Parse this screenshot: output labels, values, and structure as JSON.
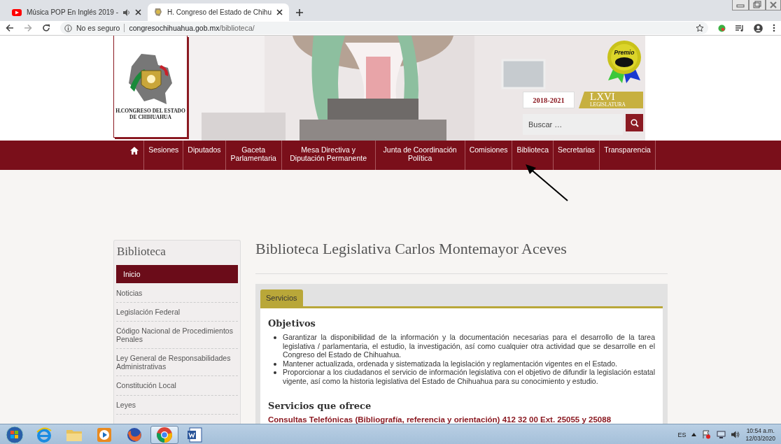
{
  "browser": {
    "tabs": [
      {
        "title": "Música POP En Inglés 2019 -",
        "selected": false,
        "audio": true
      },
      {
        "title": "H. Congreso del Estado de Chihu",
        "selected": true,
        "audio": false
      }
    ],
    "security": "No es seguro",
    "url_host": "congresochihuahua.gob.mx",
    "url_path": "/biblioteca/"
  },
  "header": {
    "logo_lines": [
      "H.CONGRESO DEL ESTADO",
      "DE CHIHUAHUA"
    ],
    "badge": "Premio",
    "period": "2018-2021",
    "legislature": "LXVI",
    "legislature_sub": "LEGISLATURA",
    "search_placeholder": "Buscar …"
  },
  "nav": [
    {
      "label": "Sesiones"
    },
    {
      "label": "Diputados"
    },
    {
      "label": "Gaceta Parlamentaria"
    },
    {
      "label": "Mesa Directiva y Diputación Permanente"
    },
    {
      "label": "Junta de Coordinación Política"
    },
    {
      "label": "Comisiones"
    },
    {
      "label": "Biblioteca"
    },
    {
      "label": "Secretarias"
    },
    {
      "label": "Transparencia"
    }
  ],
  "sidebar": {
    "title": "Biblioteca",
    "items": [
      {
        "label": "Inicio",
        "selected": true
      },
      {
        "label": "Noticias",
        "selected": false
      },
      {
        "label": "Legislación Federal",
        "selected": false
      },
      {
        "label": "Código Nacional de Procedimientos Penales",
        "selected": false
      },
      {
        "label": "Ley General de Responsabilidades Administrativas",
        "selected": false
      },
      {
        "label": "Constitución Local",
        "selected": false
      },
      {
        "label": "Leyes",
        "selected": false
      }
    ]
  },
  "main": {
    "title": "Biblioteca Legislativa Carlos Montemayor Aceves",
    "tabs": [
      {
        "label": "Servicios",
        "selected": true
      }
    ],
    "objectives_heading": "Objetivos",
    "objectives": [
      "Garantizar la disponibilidad de la información y la documentación necesarias para el desarrollo de la tarea legislativa / parlamentaria, el estudio, la investigación, así como cualquier otra actividad que se desarrolle en el Congreso del Estado de Chihuahua.",
      "Mantener actualizada, ordenada y sistematizada la legislación y reglamentación vigentes en el Estado.",
      "Proporcionar a los ciudadanos el servicio de información legislativa con el objetivo de difundir la legislación estatal vigente, así como la historia legislativa del Estado de Chihuahua para su conocimiento y estudio."
    ],
    "services_heading": "Servicios que ofrece",
    "services": [
      "Consultas Telefónicas (Bibliografía, referencia y orientación) 412 32 00 Ext. 25055 y 25088"
    ]
  },
  "taskbar": {
    "apps": [
      {
        "kind": "start",
        "active": false
      },
      {
        "kind": "ie",
        "active": false
      },
      {
        "kind": "folder",
        "active": false
      },
      {
        "kind": "media",
        "active": false
      },
      {
        "kind": "firefox",
        "active": false
      },
      {
        "kind": "chrome",
        "active": true
      },
      {
        "kind": "word",
        "active": false
      }
    ],
    "language": "ES",
    "time": "10:54 a.m.",
    "date": "12/03/2020"
  }
}
